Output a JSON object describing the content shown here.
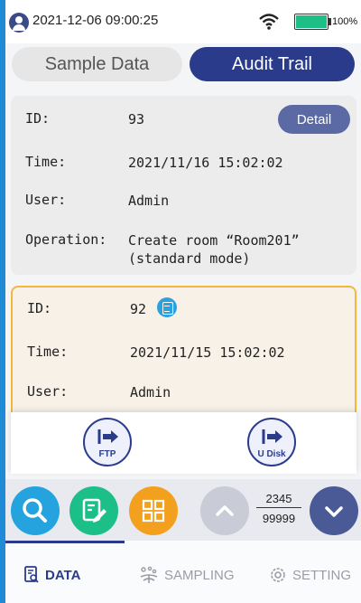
{
  "status_bar": {
    "datetime": "2021-12-06 09:00:25",
    "battery_level": 1.0,
    "battery_text": "100%",
    "battery_color": "#1dbf87"
  },
  "tabs": [
    {
      "label": "Sample Data",
      "active": false
    },
    {
      "label": "Audit Trail",
      "active": true
    }
  ],
  "records": [
    {
      "id_label": "ID:",
      "id": "93",
      "time_label": "Time:",
      "time": "2021/11/16 15:02:02",
      "user_label": "User:",
      "user": "Admin",
      "operation_label": "Operation:",
      "operation_line1": "Create room “Room201”",
      "operation_line2": "(standard mode)",
      "detail_label": "Detail"
    },
    {
      "id_label": "ID:",
      "id": "92",
      "time_label": "Time:",
      "time": "2021/11/15 15:02:02",
      "user_label": "User:",
      "user": "Admin",
      "selected": true
    }
  ],
  "export": {
    "ftp_label": "FTP",
    "udisk_label": "U Disk"
  },
  "toolbar": {
    "current_page": "2345",
    "total_pages": "99999",
    "icons": [
      "search-icon",
      "edit-icon",
      "grid-icon",
      "chevron-up-icon",
      "chevron-down-icon"
    ]
  },
  "bottom_nav": {
    "items": [
      {
        "label": "DATA",
        "icon": "data-icon",
        "active": true
      },
      {
        "label": "SAMPLING",
        "icon": "sampling-icon",
        "active": false
      },
      {
        "label": "SETTING",
        "icon": "gear-icon",
        "active": false
      }
    ]
  },
  "colors": {
    "primary": "#2b3b8c",
    "selected_border": "#f4b73c",
    "search": "#24a3de",
    "edit": "#1cbf88",
    "grid": "#f4a01f"
  }
}
